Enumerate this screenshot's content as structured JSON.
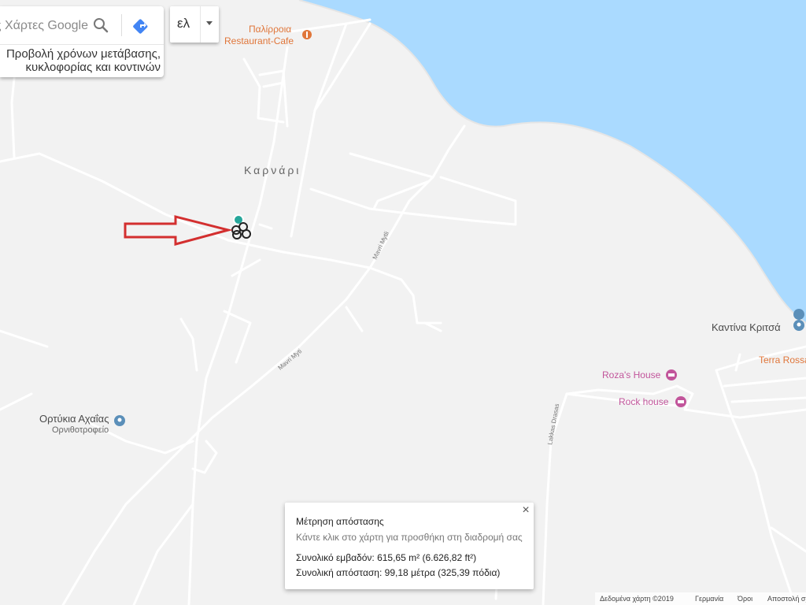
{
  "search": {
    "placeholder": "Αναζήτηση στους Χάρτες Google"
  },
  "traffic_text": "Προβολή χρόνων μετάβασης, κυκλοφορίας και κοντινών μέρων",
  "language": {
    "label": "ελ"
  },
  "places": {
    "palirroia": "Παλίρροια",
    "palirroia_sub": "Restaurant-Cafe",
    "karnari": "Καρνάρι",
    "kantina": "Καντίνα Κριτσά",
    "terra": "Terra Rossa",
    "rozas": "Roza's House",
    "rock": "Rock house",
    "ortykia": "Ορτύκια Αχαΐας",
    "ortykia_sub": "Ορνιθοτροφείο"
  },
  "streets": {
    "mavri1": "Mavri Mytli",
    "mavri2": "Mavri Myti",
    "lakkas": "Lakkas Drasas"
  },
  "measure": {
    "title": "Μέτρηση απόστασης",
    "hint": "Κάντε κλικ στο χάρτη για προσθήκη στη διαδρομή σας",
    "area": "Συνολικό εμβαδόν: 615,65 m² (6.626,82 ft²)",
    "distance": "Συνολική απόσταση: 99,18 μέτρα (325,39 πόδια)",
    "close": "×"
  },
  "attribution": {
    "data": "Δεδομένα χάρτη ©2019",
    "country": "Γερμανία",
    "terms": "Όροι",
    "send": "Αποστολή σχολίων"
  },
  "colors": {
    "water": "#aadaff",
    "land": "#f2f2f2",
    "road": "#ffffff",
    "arrow": "#d32f2f",
    "poi_orange": "#e0763a",
    "poi_pink": "#c2559b",
    "poi_blue": "#5b8fb9"
  },
  "icons": {
    "search": "search-icon",
    "directions": "directions-icon",
    "dropdown": "chevron-down-icon",
    "close": "close-icon",
    "poi": "place-pin-icon"
  }
}
